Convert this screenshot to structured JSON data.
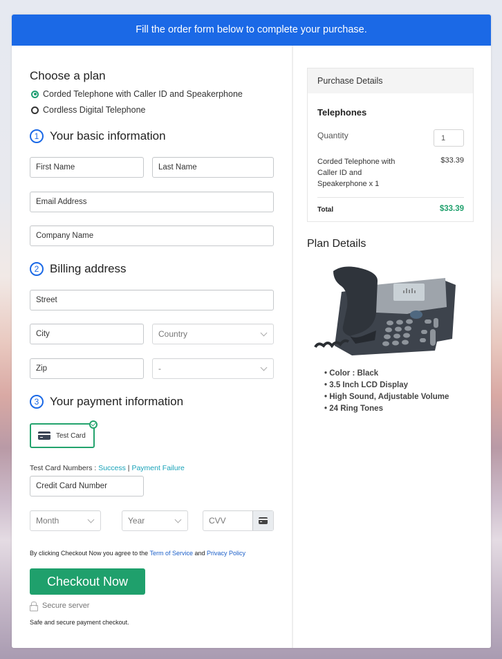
{
  "banner": {
    "text": "Fill the order form below to complete your purchase."
  },
  "plan": {
    "heading": "Choose a plan",
    "options": [
      {
        "label": "Corded Telephone with Caller ID and Speakerphone",
        "selected": true
      },
      {
        "label": "Cordless Digital Telephone",
        "selected": false
      }
    ]
  },
  "basic": {
    "number": "1",
    "heading": "Your basic information",
    "first_name": "First Name",
    "last_name": "Last Name",
    "email": "Email Address",
    "company": "Company Name"
  },
  "billing": {
    "number": "2",
    "heading": "Billing address",
    "street": "Street",
    "city": "City",
    "country": "Country",
    "zip": "Zip",
    "state": "-"
  },
  "payment": {
    "number": "3",
    "heading": "Your payment information",
    "method_label": "Test Card",
    "test_numbers_label": "Test Card Numbers : ",
    "success_link": "Success",
    "separator": " | ",
    "failure_link": "Payment Failure",
    "card_number": "Credit Card Number",
    "month": "Month",
    "year": "Year",
    "cvv": "CVV"
  },
  "terms": {
    "prefix": "By clicking Checkout Now you agree to the ",
    "tos_link": "Term of Service",
    "middle": " and ",
    "privacy_link": "Privacy Policy"
  },
  "checkout": {
    "button_label": "Checkout Now",
    "secure_label": "Secure server",
    "safe_note": "Safe and secure payment checkout."
  },
  "purchase": {
    "heading": "Purchase Details",
    "category": "Telephones",
    "quantity_label": "Quantity",
    "quantity_value": "1",
    "item_label": "Corded Telephone with Caller ID and Speakerphone x 1",
    "item_price": "$33.39",
    "total_label": "Total",
    "total_value": "$33.39",
    "total_color": "#1fa06c"
  },
  "plan_details": {
    "heading": "Plan Details",
    "image_alt": "desk-telephone",
    "features": [
      "Color : Black",
      "3.5 Inch LCD Display",
      "High Sound, Adjustable Volume",
      "24 Ring Tones"
    ]
  },
  "colors": {
    "brand_blue": "#1b69e6",
    "accent_green": "#1fa06c"
  }
}
